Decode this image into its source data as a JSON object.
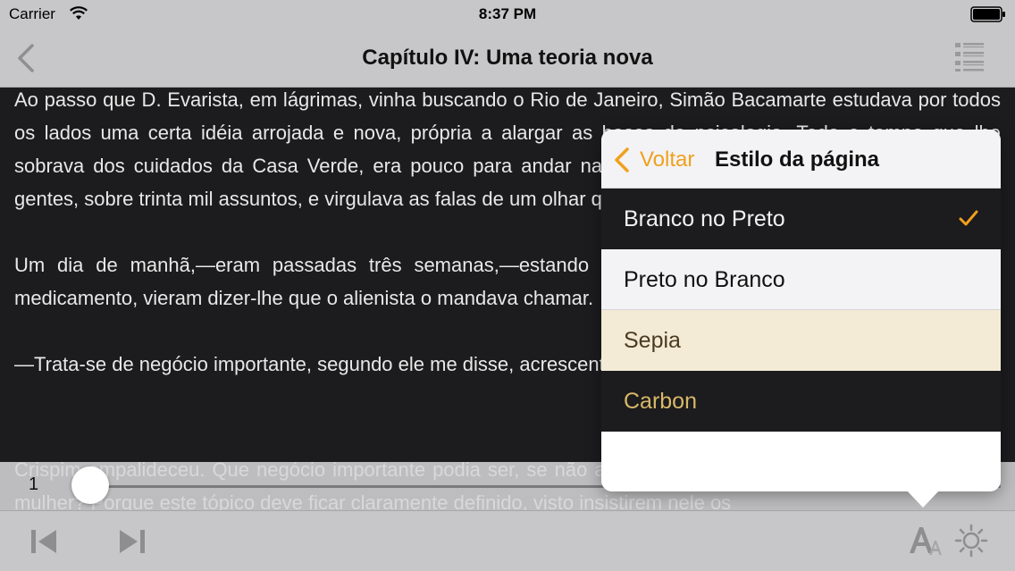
{
  "status_bar": {
    "carrier": "Carrier",
    "time": "8:37 PM"
  },
  "nav": {
    "title": "Capítulo IV: Uma teoria nova",
    "back_icon": "chevron-left-icon",
    "toc_icon": "list-icon"
  },
  "reader": {
    "paragraphs": [
      "Ao passo que D. Evarista, em lágrimas, vinha buscando o Rio de Janeiro, Simão Bacamarte estudava por todos os lados uma certa idéia arrojada e nova, própria a alargar as bases da psicologia. Todo o tempo que lhe sobrava dos cuidados da Casa Verde, era pouco para andar na rua, ou de casa em casa, conversando as gentes, sobre trinta mil assuntos, e virgulava as falas de um olhar que metia medo aos mais heróicos.",
      "Um dia de manhã,—eram passadas três semanas,—estando Crispim Soares ocupado em temperar um medicamento, vieram dizer-lhe que o alienista o mandava chamar.",
      "—Trata-se de negócio importante, segundo ele me disse, acrescentou o portador."
    ],
    "overlay_paragraph": "Crispim empalideceu. Que negócio importante podia ser, se não alguma notícia da comitiva, especialmente da mulher? Porque este tópico deve ficar claramente definido, visto insistirem nele os"
  },
  "slider": {
    "page_number": "1",
    "progress_fraction": 0.0
  },
  "popover": {
    "back_label": "Voltar",
    "title": "Estilo da página",
    "options": [
      {
        "label": "Branco no Preto",
        "selected": true
      },
      {
        "label": "Preto no Branco",
        "selected": false
      },
      {
        "label": "Sepia",
        "selected": false
      },
      {
        "label": "Carbon",
        "selected": false
      }
    ]
  },
  "toolbar": {
    "prev_icon": "skip-previous-icon",
    "next_icon": "skip-next-icon",
    "font_icon": "font-size-icon",
    "brightness_icon": "brightness-icon"
  },
  "colors": {
    "accent": "#f0a01e",
    "reader_background": "#1c1b1d",
    "bar_background": "#c7c7c9",
    "sepia_background": "#f3ebd5",
    "carbon_text": "#d8b86a"
  }
}
